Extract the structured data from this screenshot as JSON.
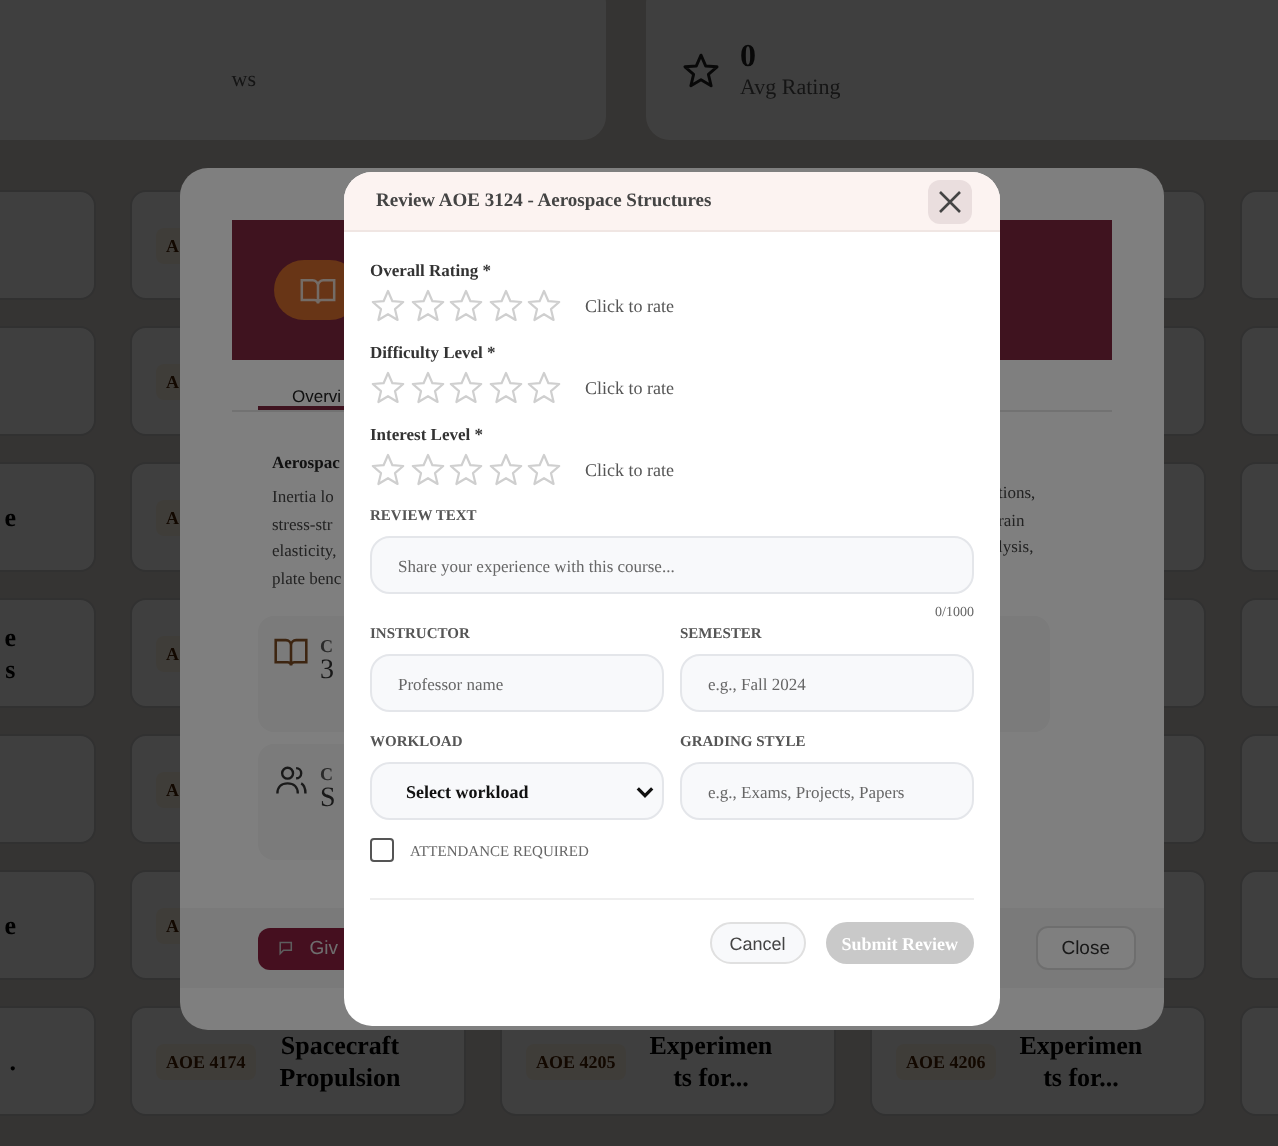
{
  "stats": [
    {
      "label": "ws"
    },
    {
      "value": "0",
      "label": "Avg Rating"
    }
  ],
  "course_grid": [
    [
      {
        "kind": "card"
      },
      {
        "kind": "card",
        "badge": "A"
      },
      {
        "kind": "gap"
      },
      {
        "kind": "card"
      },
      {
        "kind": "card"
      }
    ],
    [
      {
        "kind": "card"
      },
      {
        "kind": "card",
        "badge": "A"
      },
      {
        "kind": "gap"
      },
      {
        "kind": "card"
      },
      {
        "kind": "card"
      }
    ],
    [
      {
        "kind": "card",
        "title_lines": [
          "e"
        ]
      },
      {
        "kind": "card",
        "badge": "A"
      },
      {
        "kind": "gap"
      },
      {
        "kind": "card"
      },
      {
        "kind": "card"
      }
    ],
    [
      {
        "kind": "card",
        "title_lines": [
          "e",
          "s"
        ]
      },
      {
        "kind": "card",
        "badge": "A"
      },
      {
        "kind": "gap"
      },
      {
        "kind": "card"
      },
      {
        "kind": "card"
      }
    ],
    [
      {
        "kind": "card"
      },
      {
        "kind": "card",
        "badge": "A"
      },
      {
        "kind": "gap"
      },
      {
        "kind": "card"
      },
      {
        "kind": "card"
      }
    ],
    [
      {
        "kind": "card",
        "title_lines": [
          "e"
        ]
      },
      {
        "kind": "card",
        "badge": "A"
      },
      {
        "kind": "gap"
      },
      {
        "kind": "card"
      },
      {
        "kind": "card"
      }
    ],
    [
      {
        "kind": "card",
        "title_lines": [
          "."
        ]
      },
      {
        "kind": "card",
        "badge": "AOE 4174",
        "title_lines": [
          "Spacecraft",
          "Propulsion"
        ]
      },
      {
        "kind": "card",
        "badge": "AOE 4205",
        "title_lines": [
          "Experimen",
          "ts for..."
        ]
      },
      {
        "kind": "card",
        "badge": "AOE 4206",
        "title_lines": [
          "Experimen",
          "ts for..."
        ]
      },
      {
        "kind": "card"
      }
    ]
  ],
  "course_modal": {
    "tabs": [
      {
        "label": "Overvi",
        "selected": true
      }
    ],
    "heading": "Aerospac",
    "description_lines": [
      "Inertia lo",
      "stress-str",
      "elasticity,",
      "plate benc"
    ],
    "description_right_lines": [
      "tions,",
      "rain",
      "lysis,"
    ],
    "info_cards": [
      {
        "kind": "book",
        "label": "C",
        "value": "3"
      },
      {
        "kind": "people",
        "label": "C",
        "value": "S"
      }
    ],
    "give_button": "Giv",
    "close_button": "Close"
  },
  "review_modal": {
    "title": "Review AOE 3124 - Aerospace Structures",
    "ratings": [
      {
        "label": "Overall Rating *",
        "stars": 0,
        "hint": "Click to rate"
      },
      {
        "label": "Difficulty Level *",
        "stars": 0,
        "hint": "Click to rate"
      },
      {
        "label": "Interest Level *",
        "stars": 0,
        "hint": "Click to rate"
      }
    ],
    "review_text": {
      "label": "REVIEW TEXT",
      "placeholder": "Share your experience with this course...",
      "counter": "0/1000"
    },
    "fields": [
      {
        "kind": "input",
        "label": "INSTRUCTOR",
        "placeholder": "Professor name"
      },
      {
        "kind": "input",
        "label": "SEMESTER",
        "placeholder": "e.g., Fall 2024"
      },
      {
        "kind": "select",
        "label": "WORKLOAD",
        "value": "Select workload"
      },
      {
        "kind": "input",
        "label": "GRADING STYLE",
        "placeholder": "e.g., Exams, Projects, Papers"
      }
    ],
    "checkbox": {
      "label": "ATTENDANCE REQUIRED",
      "checked": false
    },
    "cancel_button": "Cancel",
    "submit_button": {
      "label": "Submit Review",
      "disabled": true
    }
  }
}
